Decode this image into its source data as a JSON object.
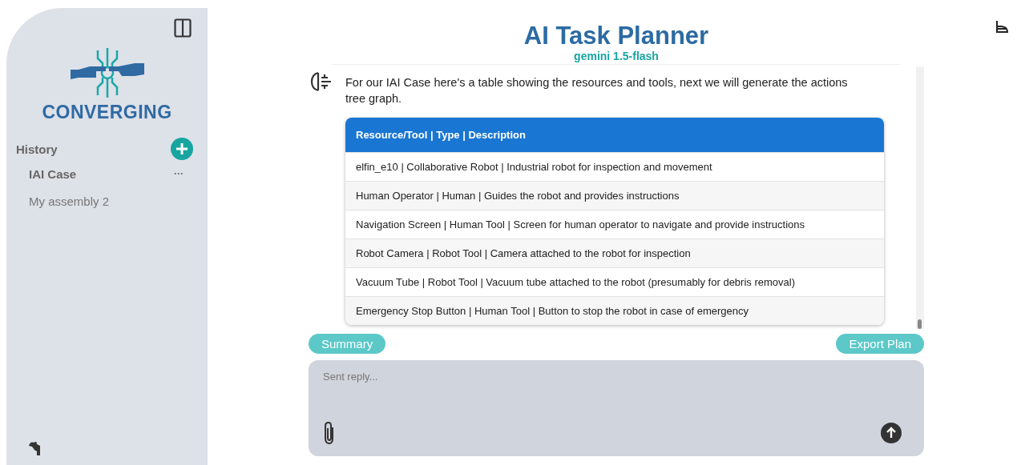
{
  "sidebar": {
    "logo_text": "CONVERGING",
    "history_label": "History",
    "items": [
      {
        "label": "IAI Case",
        "selected": true,
        "more": "···"
      },
      {
        "label": "My assembly 2",
        "selected": false
      }
    ]
  },
  "header": {
    "title": "AI Task Planner",
    "model": "gemini 1.5-flash"
  },
  "message": {
    "text": "For our IAI Case here's a table showing the resources and tools, next we will generate the actions tree graph.",
    "table": {
      "header": "Resource/Tool | Type | Description",
      "rows": [
        "elfin_e10 | Collaborative Robot | Industrial robot for inspection and movement",
        "Human Operator | Human | Guides the robot and provides instructions",
        "Navigation Screen | Human Tool | Screen for human operator to navigate and provide instructions",
        "Robot Camera | Robot Tool | Camera attached to the robot for inspection",
        "Vacuum Tube | Robot Tool | Vacuum tube attached to the robot (presumably for debris removal)",
        "Emergency Stop Button | Human Tool | Button to stop the robot in case of emergency"
      ]
    }
  },
  "actions": [
    "Summary",
    "Export Plan"
  ],
  "composer": {
    "placeholder": "Sent reply..."
  }
}
